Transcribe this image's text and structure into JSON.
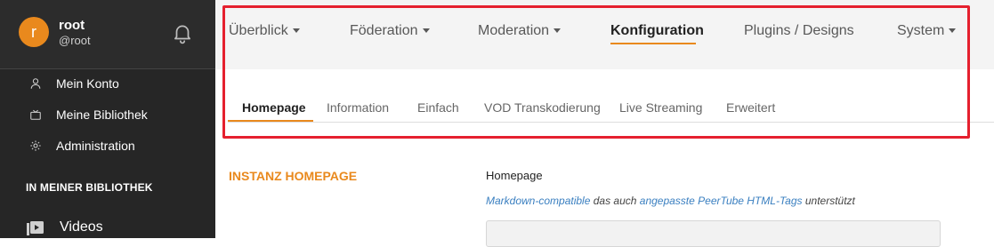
{
  "sidebar": {
    "user": {
      "avatar_letter": "r",
      "name": "root",
      "handle": "@root"
    },
    "notifications_icon": "bell-icon",
    "menu": [
      {
        "label": "Mein Konto",
        "icon": "user-icon"
      },
      {
        "label": "Meine Bibliothek",
        "icon": "library-icon"
      },
      {
        "label": "Administration",
        "icon": "gear-icon"
      }
    ],
    "section_title": "IN MEINER BIBLIOTHEK",
    "videos": {
      "label": "Videos",
      "icon": "videos-icon"
    }
  },
  "topnav": {
    "items": [
      {
        "label": "Überblick"
      },
      {
        "label": "Föderation"
      },
      {
        "label": "Moderation"
      },
      {
        "label": "Konfiguration"
      },
      {
        "label": "Plugins / Designs"
      },
      {
        "label": "System"
      }
    ]
  },
  "subtabs": {
    "items": [
      {
        "label": "Homepage"
      },
      {
        "label": "Information"
      },
      {
        "label": "Einfach"
      },
      {
        "label": "VOD Transkodierung"
      },
      {
        "label": "Live Streaming"
      },
      {
        "label": "Erweitert"
      }
    ]
  },
  "content": {
    "section_heading": "INSTANZ HOMEPAGE",
    "field_label": "Homepage",
    "help_link_1": "Markdown-compatible",
    "help_text_1": " das auch ",
    "help_link_2": "angepasste PeerTube HTML-Tags",
    "help_text_2": " unterstützt"
  },
  "colors": {
    "accent": "#e9891d",
    "sidebar_bg": "#262626",
    "highlight": "#e5202e",
    "link": "#3a7fc0"
  }
}
